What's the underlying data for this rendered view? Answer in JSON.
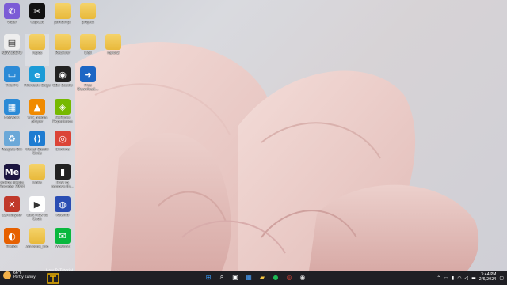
{
  "desktop": {
    "icons": [
      {
        "label": "Viber",
        "glyph": "✆",
        "color": "#7b5cd6"
      },
      {
        "label": "CapCut",
        "glyph": "✂",
        "color": "#111111"
      },
      {
        "label": "jamovi-pi",
        "glyph": "",
        "color": "folder"
      },
      {
        "label": "project",
        "glyph": "",
        "color": "folder"
      },
      {
        "label": "KDWC6E7D",
        "glyph": "▤",
        "color": "#eeeeee"
      },
      {
        "label": "repos",
        "glyph": "",
        "color": "folder"
      },
      {
        "label": "Recover",
        "glyph": "",
        "color": "folder"
      },
      {
        "label": "Dell",
        "glyph": "",
        "color": "folder"
      },
      {
        "label": "repos2",
        "glyph": "",
        "color": "folder"
      },
      {
        "label": "This PC",
        "glyph": "▭",
        "color": "#2b8ad6"
      },
      {
        "label": "Microsoft Edge",
        "glyph": "e",
        "color": "#1b9bd7"
      },
      {
        "label": "OBS Studio",
        "glyph": "◉",
        "color": "#222222"
      },
      {
        "label": "Free Download...",
        "glyph": "➜",
        "color": "#1d66c4"
      },
      {
        "label": "Network",
        "glyph": "▦",
        "color": "#2b8ad6"
      },
      {
        "label": "VLC media player",
        "glyph": "▲",
        "color": "#f08a00"
      },
      {
        "label": "GeForce Experience",
        "glyph": "◈",
        "color": "#76b900"
      },
      {
        "label": "Recycle Bin",
        "glyph": "♻",
        "color": "#6aa8d8"
      },
      {
        "label": "Visual Studio Code",
        "glyph": "⟨⟩",
        "color": "#1e7cd1"
      },
      {
        "label": "Chrome",
        "glyph": "◎",
        "color": "#db4437"
      },
      {
        "label": "Adobe Media Encoder 2024",
        "glyph": "Me",
        "color": "#1c1640"
      },
      {
        "label": "Links",
        "glyph": "",
        "color": "folder"
      },
      {
        "label": "How to remove th...",
        "glyph": "▮",
        "color": "#222222"
      },
      {
        "label": "EZAnalyzer",
        "glyph": "✕",
        "color": "#c0392b"
      },
      {
        "label": "Lust How to Cook",
        "glyph": "▶",
        "color": "#ffffff"
      },
      {
        "label": "Rewind",
        "glyph": "◍",
        "color": "#2a4db3"
      },
      {
        "label": "Firefox",
        "glyph": "◐",
        "color": "#e66000"
      },
      {
        "label": "Autocue_Pro",
        "glyph": "",
        "color": "folder"
      },
      {
        "label": "WeChat",
        "glyph": "✉",
        "color": "#09b83e"
      }
    ]
  },
  "taskbar": {
    "weather_temp": "66°F",
    "weather_desc": "Partly sunny",
    "logo_text": "How To Tutorial",
    "apps": [
      {
        "name": "windows-start-icon",
        "glyph": "⊞",
        "color": "#3aa0ff"
      },
      {
        "name": "search-icon",
        "glyph": "⌕",
        "color": "#ffffff"
      },
      {
        "name": "task-view-icon",
        "glyph": "▣",
        "color": "#ffffff"
      },
      {
        "name": "store-icon",
        "glyph": "▦",
        "color": "#4aa3ff"
      },
      {
        "name": "file-explorer-icon",
        "glyph": "▰",
        "color": "#f5c542"
      },
      {
        "name": "spotify-icon",
        "glyph": "●",
        "color": "#1db954"
      },
      {
        "name": "chrome-icon",
        "glyph": "◎",
        "color": "#db4437"
      },
      {
        "name": "recording-icon",
        "glyph": "◉",
        "color": "#dddddd"
      }
    ],
    "clock_time": "3:44 PM",
    "clock_date": "2/6/2024"
  }
}
